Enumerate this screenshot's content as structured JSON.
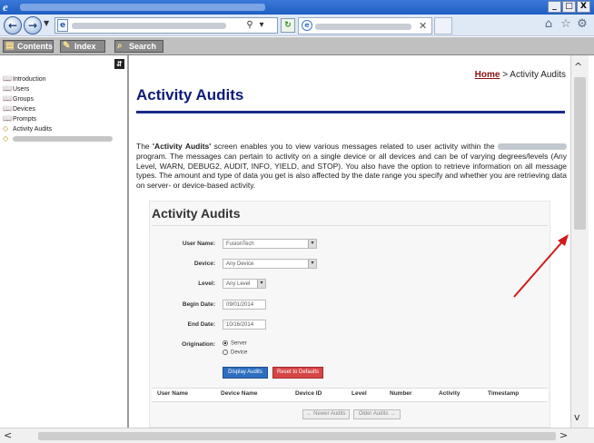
{
  "window": {
    "minimize_label": "_",
    "maximize_label": "□",
    "close_label": "X"
  },
  "help_toolbar": {
    "contents_label": "Contents",
    "index_label": "Index",
    "search_label": "Search"
  },
  "toc": {
    "items": [
      {
        "label": "Introduction",
        "icon": "book-icon"
      },
      {
        "label": "Users",
        "icon": "book-icon"
      },
      {
        "label": "Groups",
        "icon": "book-icon"
      },
      {
        "label": "Devices",
        "icon": "book-icon"
      },
      {
        "label": "Prompts",
        "icon": "book-icon"
      },
      {
        "label": "Activity Audits",
        "icon": "page-icon"
      }
    ]
  },
  "breadcrumb": {
    "home_label": "Home",
    "separator": " > ",
    "current": "Activity Audits"
  },
  "page": {
    "title": "Activity Audits",
    "intro_part1": "The ",
    "intro_bold": "'Activity Audits'",
    "intro_part2": " screen enables you to view various messages related to user activity within the ",
    "intro_part3": " program. The messages can pertain to activity on a single device or all devices and can be of varying degrees/levels (Any Level, WARN, DEBUG2, AUDIT, INFO, YIELD, and STOP). You also have the option to retrieve information on all message types. The amount and type of data you get is also affected by the date range you specify and whether you are retrieving data on server- or device-based activity."
  },
  "screenshot": {
    "title": "Activity Audits",
    "fields": {
      "user_name_label": "User Name:",
      "user_name_value": "FusionTech",
      "device_label": "Device:",
      "device_value": "Any Device",
      "level_label": "Level:",
      "level_value": "Any Level",
      "begin_date_label": "Begin Date:",
      "begin_date_value": "09/01/2014",
      "end_date_label": "End Date:",
      "end_date_value": "10/16/2014",
      "origination_label": "Origination:",
      "option_server": "Server",
      "option_device": "Device"
    },
    "display_button": "Display Audits",
    "reset_button": "Reset to Defaults",
    "columns": [
      "User Name",
      "Device Name",
      "Device ID",
      "Level",
      "Number",
      "Activity",
      "Timestamp"
    ],
    "newer_button": "← Newer Audits",
    "older_button": "Older Audits →"
  },
  "colors": {
    "title_blue": "#0e1a7a",
    "breadcrumb_home": "#8b1010",
    "annotation_arrow": "#d21a1a",
    "display_button": "#2d6fbf",
    "reset_button": "#d64545"
  }
}
